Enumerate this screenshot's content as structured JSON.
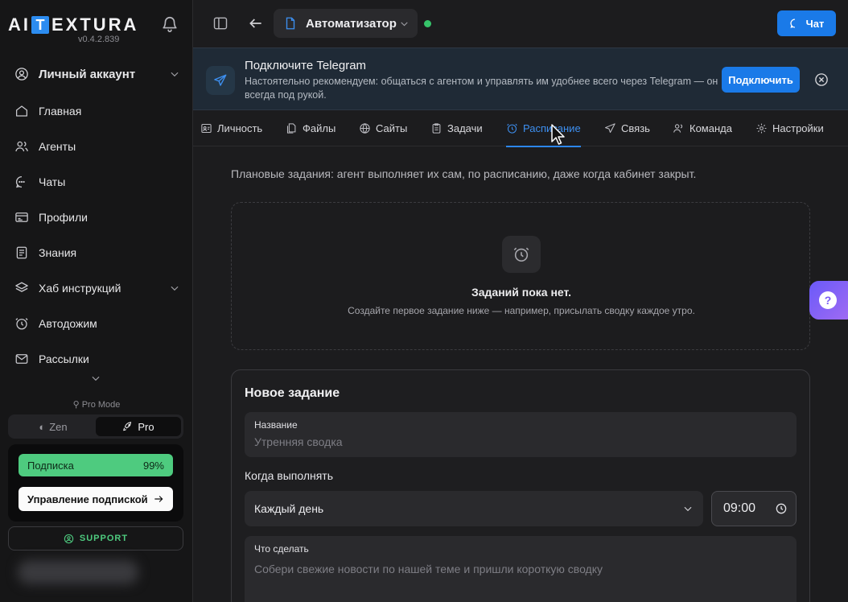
{
  "sidebar": {
    "logo_left": "AI",
    "logo_box": "T",
    "logo_right": "EXTURA",
    "version": "v0.4.2.839",
    "account_label": "Личный аккаунт",
    "items": [
      {
        "label": "Главная"
      },
      {
        "label": "Агенты"
      },
      {
        "label": "Чаты"
      },
      {
        "label": "Профили"
      },
      {
        "label": "Знания"
      },
      {
        "label": "Хаб инструкций"
      },
      {
        "label": "Автодожим"
      },
      {
        "label": "Рассылки"
      }
    ],
    "pro_mode_label": "Pro Mode",
    "modes": {
      "zen": "Zen",
      "pro": "Pro"
    },
    "subscription": {
      "label": "Подписка",
      "percent": "99%",
      "manage_label": "Управление подпиской"
    },
    "support_label": "SUPPORT"
  },
  "topbar": {
    "agent_name": "Автоматизатор",
    "chat_label": "Чат"
  },
  "banner": {
    "title": "Подключите Telegram",
    "text": "Настоятельно рекомендуем: общаться с агентом и управлять им удобнее всего через Telegram — он всегда под рукой.",
    "connect_label": "Подключить"
  },
  "tabs": [
    {
      "label": "Личность"
    },
    {
      "label": "Файлы"
    },
    {
      "label": "Сайты"
    },
    {
      "label": "Задачи"
    },
    {
      "label": "Расписание"
    },
    {
      "label": "Связь"
    },
    {
      "label": "Команда"
    },
    {
      "label": "Настройки"
    }
  ],
  "main": {
    "description": "Плановые задания: агент выполняет их сам, по расписанию, даже когда кабинет закрыт.",
    "empty_title": "Заданий пока нет.",
    "empty_sub": "Создайте первое задание ниже — например, присылать сводку каждое утро."
  },
  "new_task": {
    "title": "Новое задание",
    "name_label": "Название",
    "name_placeholder": "Утренняя сводка",
    "when_label": "Когда выполнять",
    "frequency": "Каждый день",
    "time": "09:00",
    "what_label": "Что сделать",
    "what_placeholder": "Собери свежие новости по нашей теме и пришли короткую сводку"
  },
  "colors": {
    "accent": "#1a7ae8",
    "success": "#4ecb7f",
    "online": "#36c46a"
  }
}
